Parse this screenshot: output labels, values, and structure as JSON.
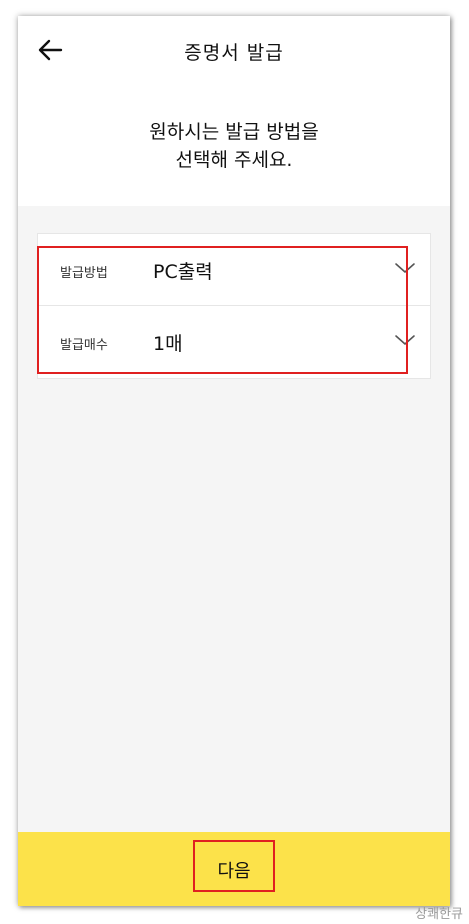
{
  "header": {
    "title": "증명서 발급",
    "back_icon": "arrow-left-icon",
    "guide_line1": "원하시는 발급 방법을",
    "guide_line2": "선택해 주세요."
  },
  "options": [
    {
      "label": "발급방법",
      "value": "PC출력",
      "icon": "chevron-down-icon"
    },
    {
      "label": "발급매수",
      "value": "1매",
      "icon": "chevron-down-icon"
    }
  ],
  "footer": {
    "next_label": "다음"
  },
  "watermark": "상쾌한큐",
  "colors": {
    "accent": "#fce24a",
    "highlight": "#e02020",
    "background": "#f5f5f5"
  }
}
